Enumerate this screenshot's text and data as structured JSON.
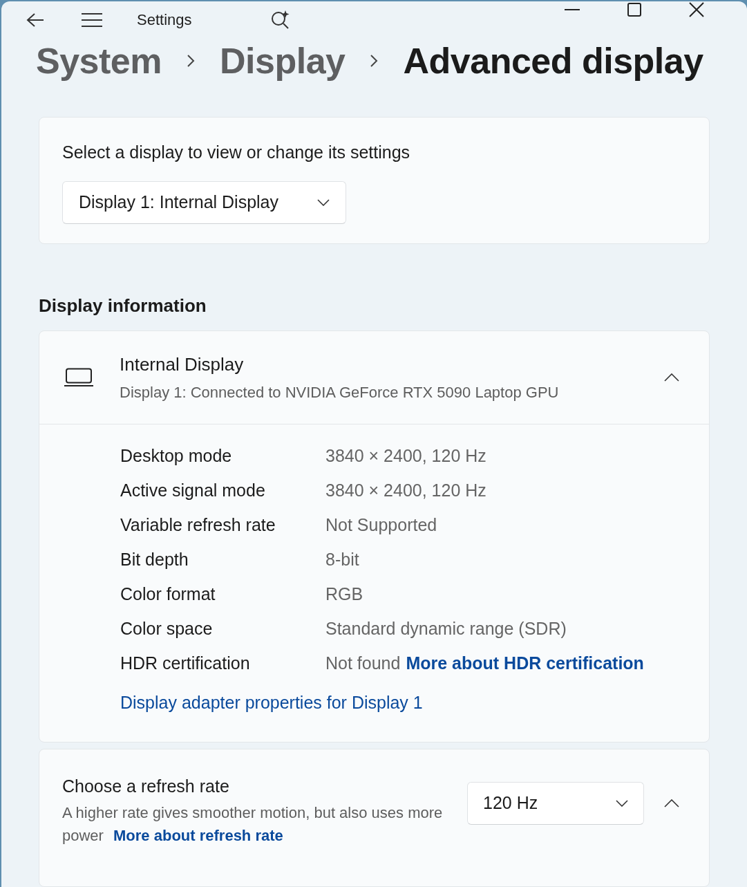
{
  "window": {
    "title": "Settings"
  },
  "breadcrumb": [
    {
      "label": "System",
      "current": false
    },
    {
      "label": "Display",
      "current": false
    },
    {
      "label": "Advanced display",
      "current": true
    }
  ],
  "display_select": {
    "label": "Select a display to view or change its settings",
    "value": "Display 1: Internal Display"
  },
  "section_title": "Display information",
  "display_card": {
    "title": "Internal Display",
    "subtitle": "Display 1: Connected to NVIDIA GeForce RTX 5090 Laptop GPU",
    "expanded": true,
    "rows": [
      {
        "label": "Desktop mode",
        "value": "3840 × 2400, 120 Hz"
      },
      {
        "label": "Active signal mode",
        "value": "3840 × 2400, 120 Hz"
      },
      {
        "label": "Variable refresh rate",
        "value": "Not Supported"
      },
      {
        "label": "Bit depth",
        "value": "8-bit"
      },
      {
        "label": "Color format",
        "value": "RGB"
      },
      {
        "label": "Color space",
        "value": "Standard dynamic range (SDR)"
      },
      {
        "label": "HDR certification",
        "value": "Not found",
        "link": "More about HDR certification"
      }
    ],
    "adapter_link": "Display adapter properties for Display 1"
  },
  "refresh_card": {
    "title": "Choose a refresh rate",
    "description": "A higher rate gives smoother motion, but also uses more power",
    "link": "More about refresh rate",
    "value": "120 Hz",
    "expanded": true
  }
}
